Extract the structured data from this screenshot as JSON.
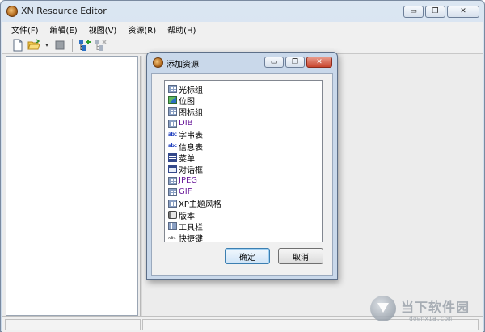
{
  "window": {
    "title": "XN Resource Editor",
    "minimize_glyph": "▭",
    "restore_glyph": "❐",
    "close_glyph": "✕"
  },
  "menu": {
    "items": [
      {
        "label": "文件(F)"
      },
      {
        "label": "编辑(E)"
      },
      {
        "label": "视图(V)"
      },
      {
        "label": "资源(R)"
      },
      {
        "label": "帮助(H)"
      }
    ]
  },
  "toolbar": {
    "buttons": [
      "new-file-icon",
      "open-folder-icon",
      "dropdown-caret-icon",
      "stop-icon",
      "add-resource-icon",
      "remove-resource-icon"
    ],
    "caret": "▾"
  },
  "dialog": {
    "title": "添加资源",
    "items": [
      {
        "label": "光标组",
        "icon": "cursor-group-icon"
      },
      {
        "label": "位图",
        "icon": "bitmap-icon"
      },
      {
        "label": "图标组",
        "icon": "icon-group-icon"
      },
      {
        "label": "DIB",
        "icon": "dib-icon"
      },
      {
        "label": "字串表",
        "icon": "string-table-icon"
      },
      {
        "label": "信息表",
        "icon": "message-table-icon"
      },
      {
        "label": "菜单",
        "icon": "menu-icon"
      },
      {
        "label": "对话框",
        "icon": "dialog-icon"
      },
      {
        "label": "JPEG",
        "icon": "jpeg-icon"
      },
      {
        "label": "GIF",
        "icon": "gif-icon"
      },
      {
        "label": "XP主题风格",
        "icon": "xp-theme-icon"
      },
      {
        "label": "版本",
        "icon": "version-icon"
      },
      {
        "label": "工具栏",
        "icon": "toolbar-icon"
      },
      {
        "label": "快捷键",
        "icon": "accelerator-icon"
      }
    ],
    "ok_label": "确定",
    "cancel_label": "取消"
  },
  "watermark": {
    "cn": "当下软件园",
    "en": "downxia.com"
  }
}
